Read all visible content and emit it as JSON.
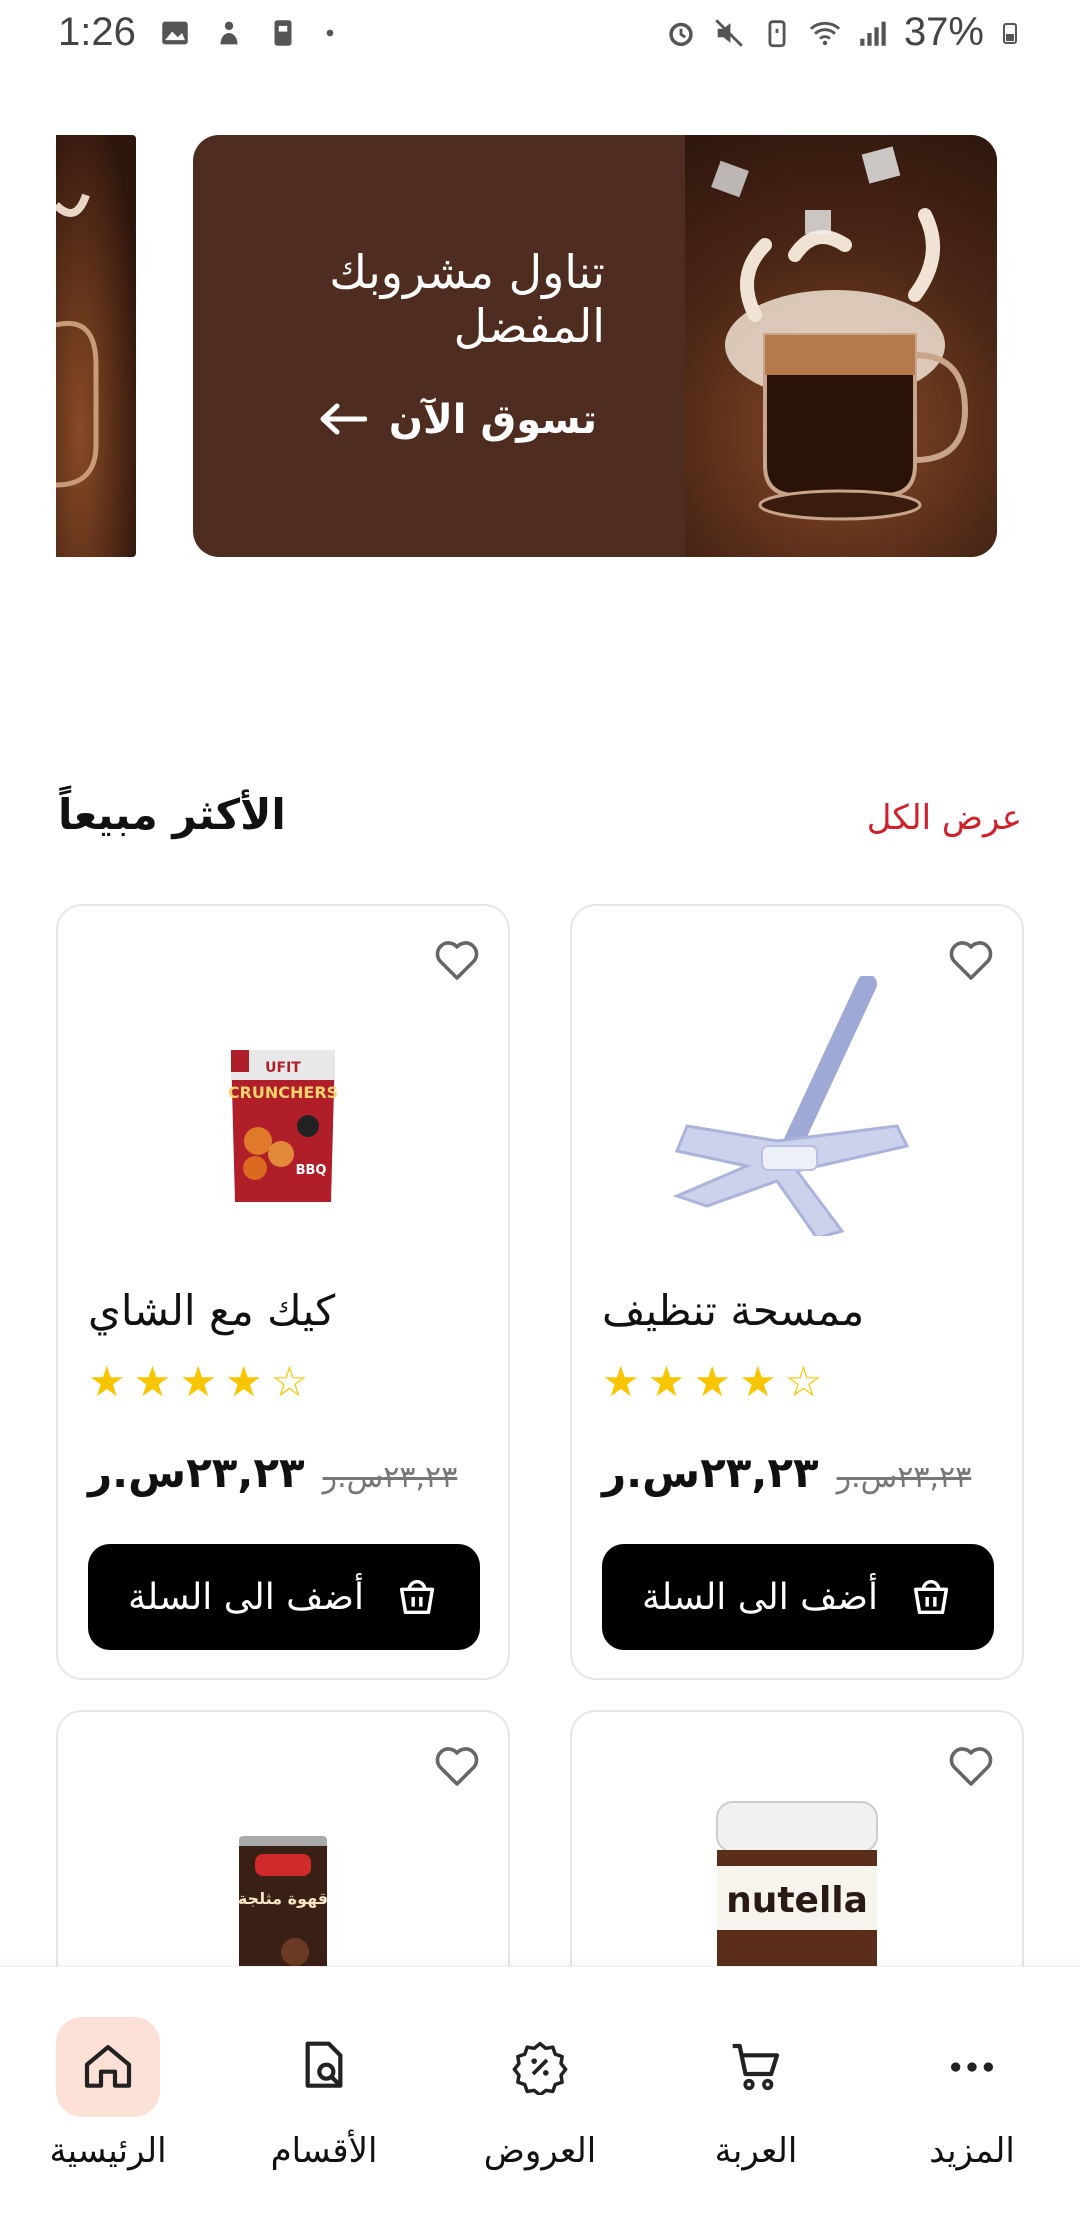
{
  "status_bar": {
    "time": "1:26",
    "battery": "37%"
  },
  "banner": {
    "title": "تناول مشروبك المفضل",
    "cta": "تسوق الآن"
  },
  "best_sellers": {
    "title": "الأكثر مبيعاً",
    "view_all": "عرض الكل"
  },
  "products": [
    {
      "name": "كيك مع الشاي",
      "rating": 4,
      "price": "٢٣,٢٣س.ر",
      "old_price": "٢٣,٢٣س.ر",
      "add_label": "أضف الى السلة"
    },
    {
      "name": "ممسحة تنظيف",
      "rating": 4,
      "price": "٢٣,٢٣س.ر",
      "old_price": "٢٣,٢٣س.ر",
      "add_label": "أضف الى السلة"
    }
  ],
  "product_images": {
    "chips_brand": "UFIT",
    "chips_name": "CRUNCHERS",
    "chips_flavor": "BBQ",
    "coffee_can": "قهوة مثلجة",
    "nutella": "nutella"
  },
  "bottom_nav": [
    {
      "label": "الرئيسية",
      "icon": "home-icon",
      "active": true
    },
    {
      "label": "الأقسام",
      "icon": "categories-icon",
      "active": false
    },
    {
      "label": "العروض",
      "icon": "offers-icon",
      "active": false
    },
    {
      "label": "العربة",
      "icon": "cart-icon",
      "active": false
    },
    {
      "label": "المزيد",
      "icon": "more-icon",
      "active": false
    }
  ],
  "colors": {
    "accent_red": "#d0202a",
    "banner_brown": "#4e2c20",
    "star_yellow": "#f7c600",
    "active_nav_bg": "#fde1d6"
  }
}
